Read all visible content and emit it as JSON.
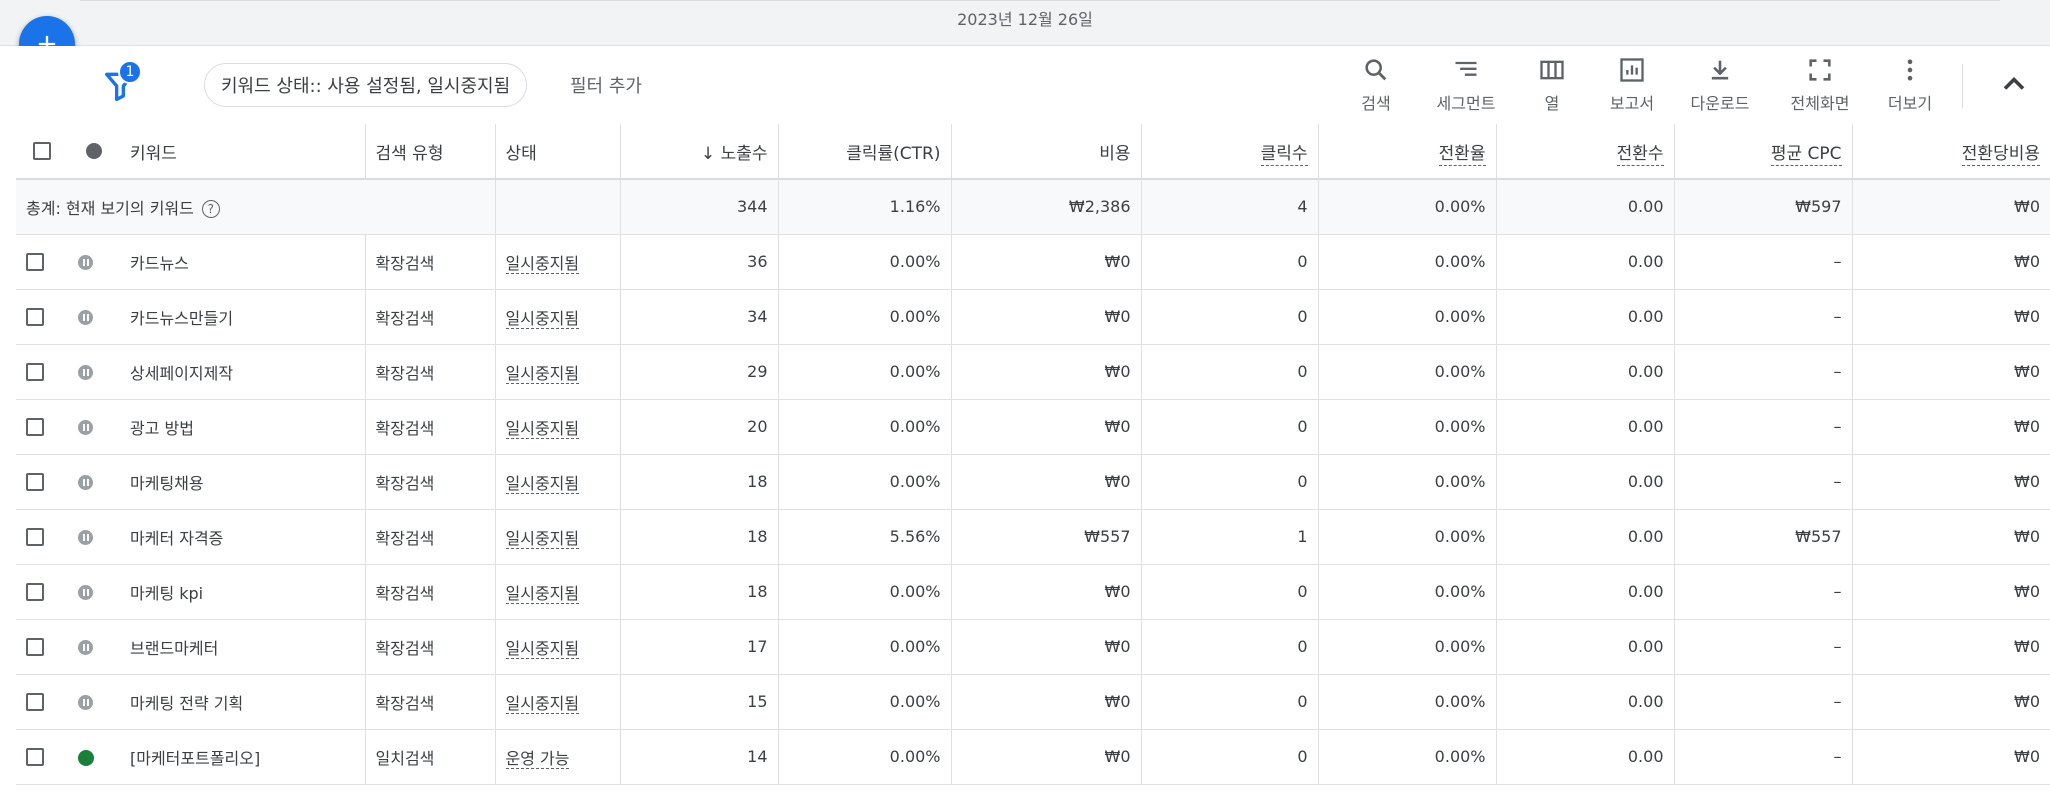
{
  "header": {
    "date_label": "2023년 12월 26일"
  },
  "filters": {
    "count_badge": "1",
    "active_chip": "키워드 상태:: 사용 설정됨, 일시중지됨",
    "add_filter": "필터 추가"
  },
  "toolbar": {
    "search": "검색",
    "segment": "세그먼트",
    "columns": "열",
    "report": "보고서",
    "download": "다운로드",
    "fullscreen": "전체화면",
    "more": "더보기"
  },
  "table": {
    "headers": {
      "keyword": "키워드",
      "match_type": "검색 유형",
      "status": "상태",
      "impressions": "노출수",
      "ctr": "클릭률(CTR)",
      "cost": "비용",
      "clicks": "클릭수",
      "conv_rate": "전환율",
      "conversions": "전환수",
      "avg_cpc": "평균 CPC",
      "cost_per_conv": "전환당비용"
    },
    "totals": {
      "label": "총계: 현재 보기의 키워드",
      "impressions": "344",
      "ctr": "1.16%",
      "cost": "₩2,386",
      "clicks": "4",
      "conv_rate": "0.00%",
      "conversions": "0.00",
      "avg_cpc": "₩597",
      "cost_per_conv": "₩0"
    },
    "rows": [
      {
        "status_icon": "paused",
        "keyword": "카드뉴스",
        "match": "확장검색",
        "status": "일시중지됨",
        "impr": "36",
        "ctr": "0.00%",
        "cost": "₩0",
        "clicks": "0",
        "conv_rate": "0.00%",
        "conv": "0.00",
        "cpc": "–",
        "cpa": "₩0"
      },
      {
        "status_icon": "paused",
        "keyword": "카드뉴스만들기",
        "match": "확장검색",
        "status": "일시중지됨",
        "impr": "34",
        "ctr": "0.00%",
        "cost": "₩0",
        "clicks": "0",
        "conv_rate": "0.00%",
        "conv": "0.00",
        "cpc": "–",
        "cpa": "₩0"
      },
      {
        "status_icon": "paused",
        "keyword": "상세페이지제작",
        "match": "확장검색",
        "status": "일시중지됨",
        "impr": "29",
        "ctr": "0.00%",
        "cost": "₩0",
        "clicks": "0",
        "conv_rate": "0.00%",
        "conv": "0.00",
        "cpc": "–",
        "cpa": "₩0"
      },
      {
        "status_icon": "paused",
        "keyword": "광고 방법",
        "match": "확장검색",
        "status": "일시중지됨",
        "impr": "20",
        "ctr": "0.00%",
        "cost": "₩0",
        "clicks": "0",
        "conv_rate": "0.00%",
        "conv": "0.00",
        "cpc": "–",
        "cpa": "₩0"
      },
      {
        "status_icon": "paused",
        "keyword": "마케팅채용",
        "match": "확장검색",
        "status": "일시중지됨",
        "impr": "18",
        "ctr": "0.00%",
        "cost": "₩0",
        "clicks": "0",
        "conv_rate": "0.00%",
        "conv": "0.00",
        "cpc": "–",
        "cpa": "₩0"
      },
      {
        "status_icon": "paused",
        "keyword": "마케터 자격증",
        "match": "확장검색",
        "status": "일시중지됨",
        "impr": "18",
        "ctr": "5.56%",
        "cost": "₩557",
        "clicks": "1",
        "conv_rate": "0.00%",
        "conv": "0.00",
        "cpc": "₩557",
        "cpa": "₩0"
      },
      {
        "status_icon": "paused",
        "keyword": "마케팅 kpi",
        "match": "확장검색",
        "status": "일시중지됨",
        "impr": "18",
        "ctr": "0.00%",
        "cost": "₩0",
        "clicks": "0",
        "conv_rate": "0.00%",
        "conv": "0.00",
        "cpc": "–",
        "cpa": "₩0"
      },
      {
        "status_icon": "paused",
        "keyword": "브랜드마케터",
        "match": "확장검색",
        "status": "일시중지됨",
        "impr": "17",
        "ctr": "0.00%",
        "cost": "₩0",
        "clicks": "0",
        "conv_rate": "0.00%",
        "conv": "0.00",
        "cpc": "–",
        "cpa": "₩0"
      },
      {
        "status_icon": "paused",
        "keyword": "마케팅 전략 기획",
        "match": "확장검색",
        "status": "일시중지됨",
        "impr": "15",
        "ctr": "0.00%",
        "cost": "₩0",
        "clicks": "0",
        "conv_rate": "0.00%",
        "conv": "0.00",
        "cpc": "–",
        "cpa": "₩0"
      },
      {
        "status_icon": "enabled",
        "keyword": "[마케터포트폴리오]",
        "match": "일치검색",
        "status": "운영 가능",
        "impr": "14",
        "ctr": "0.00%",
        "cost": "₩0",
        "clicks": "0",
        "conv_rate": "0.00%",
        "conv": "0.00",
        "cpc": "–",
        "cpa": "₩0"
      }
    ]
  },
  "colors": {
    "accent": "#1a73e8",
    "enabled_dot": "#188038",
    "paused_dot": "#9aa0a6"
  }
}
